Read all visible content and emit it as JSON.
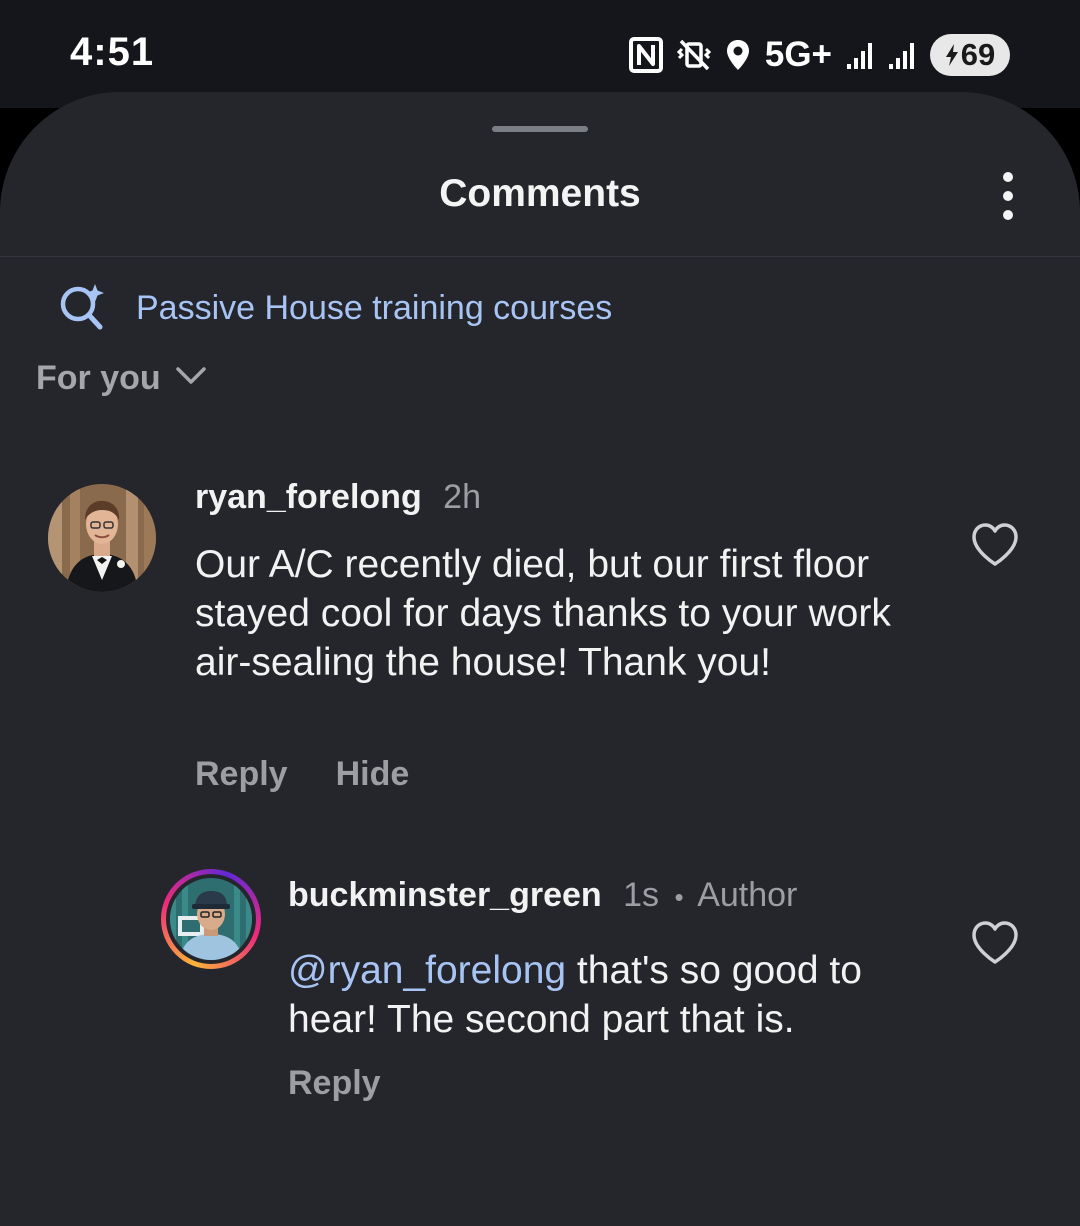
{
  "status_bar": {
    "time": "4:51",
    "network": "5G+",
    "battery": "69",
    "icons": [
      "nfc-icon",
      "vibrate-icon",
      "location-icon",
      "signal-icon",
      "signal-icon",
      "battery-charging-icon"
    ]
  },
  "sheet": {
    "title": "Comments",
    "menu_icon": "more-vertical-icon"
  },
  "search_suggestion": {
    "icon": "sparkle-search-icon",
    "label": "Passive House training courses"
  },
  "sort": {
    "label": "For you",
    "icon": "chevron-down-icon"
  },
  "comments": [
    {
      "username": "ryan_forelong",
      "time": "2h",
      "text": "Our A/C recently died, but our first floor stayed cool for days thanks to your work air-sealing the house! Thank you!",
      "actions": {
        "reply": "Reply",
        "hide": "Hide"
      },
      "icon": "heart-icon"
    },
    {
      "username": "buckminster_green",
      "time": "1s",
      "separator": "•",
      "tag": "Author",
      "mention": "@ryan_forelong",
      "text": " that's so good to hear! The second part that is.",
      "actions": {
        "reply": "Reply"
      },
      "icon": "heart-icon"
    }
  ],
  "colors": {
    "sheet_background": "#24262c",
    "accent_link": "#a8c4f4",
    "primary_text": "#f2f2f2",
    "secondary_text": "#9c9ea4",
    "story_ring": [
      "#f9b53a",
      "#ee2a7b",
      "#6228d7"
    ]
  }
}
